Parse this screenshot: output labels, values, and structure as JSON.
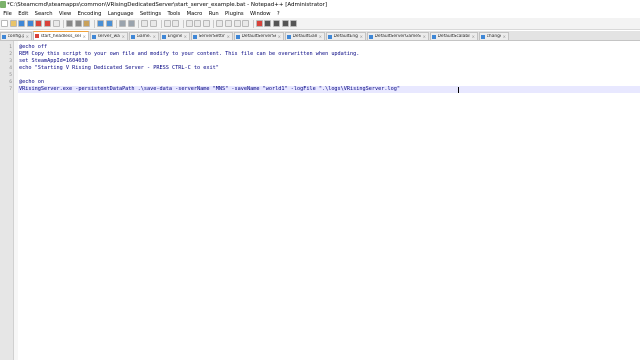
{
  "window": {
    "title": "*C:\\Steamcmd\\steamapps\\common\\VRisingDedicatedServer\\start_server_example.bat - Notepad++ [Administrator]"
  },
  "menu": [
    "File",
    "Edit",
    "Search",
    "View",
    "Encoding",
    "Language",
    "Settings",
    "Tools",
    "Macro",
    "Run",
    "Plugins",
    "Window",
    "?"
  ],
  "tabs": [
    {
      "label": "config.ps"
    },
    {
      "label": "start_headless_server.bat"
    },
    {
      "label": "server_wall.cfg"
    },
    {
      "label": "Game.ini"
    },
    {
      "label": "Engine.ini"
    },
    {
      "label": "ServerSettings.ini"
    },
    {
      "label": "DefaultServerSettings.ini"
    },
    {
      "label": "DefaultGame.ini"
    },
    {
      "label": "DefaultEngine.ini"
    },
    {
      "label": "DefaultServerGameSettings.ini"
    },
    {
      "label": "DefaultScalability.ini"
    },
    {
      "label": "changelog.txt"
    }
  ],
  "active_tab_index": 1,
  "editor": {
    "current_line": 7,
    "lines": [
      "@echo off",
      "REM Copy this script to your own file and modify to your content. This file can be overwritten when updating.",
      "set SteamAppId=1604030",
      "echo \"Starting V Rising Dedicated Server - PRESS CTRL-C to exit\"",
      "",
      "@echo on",
      "VRisingServer.exe -persistentDataPath .\\save-data -serverName \"MNS\" -saveName \"world1\" -logFile \".\\logs\\VRisingServer.log\""
    ]
  },
  "colors": {
    "code_text": "#000080",
    "current_line": "#e8e8ff",
    "gutter": "#e6e6e6",
    "active_tab_accent": "#f2a33a"
  }
}
